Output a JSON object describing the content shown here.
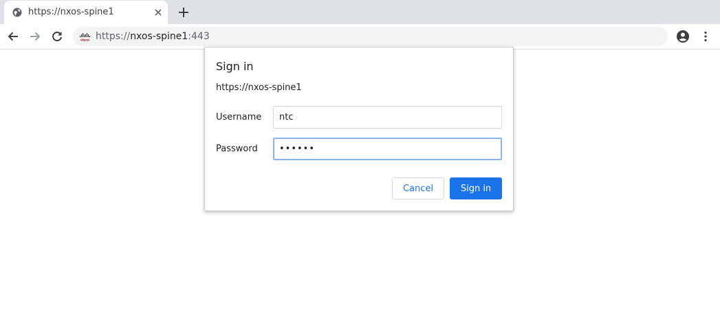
{
  "tab": {
    "title": "https://nxos-spine1",
    "favicon": "globe-icon"
  },
  "toolbar": {
    "url_scheme": "https://",
    "url_host": "nxos-spine1",
    "url_port": ":443",
    "site_icon": "cisco-logo-icon"
  },
  "dialog": {
    "title": "Sign in",
    "origin": "https://nxos-spine1",
    "username_label": "Username",
    "username_value": "ntc",
    "password_label": "Password",
    "password_value": "••••••",
    "cancel_label": "Cancel",
    "signin_label": "Sign in"
  },
  "colors": {
    "accent": "#1a73e8",
    "tabstrip": "#dee1e6",
    "omnibox": "#f1f3f4",
    "focus_ring": "#8ab4f8"
  }
}
